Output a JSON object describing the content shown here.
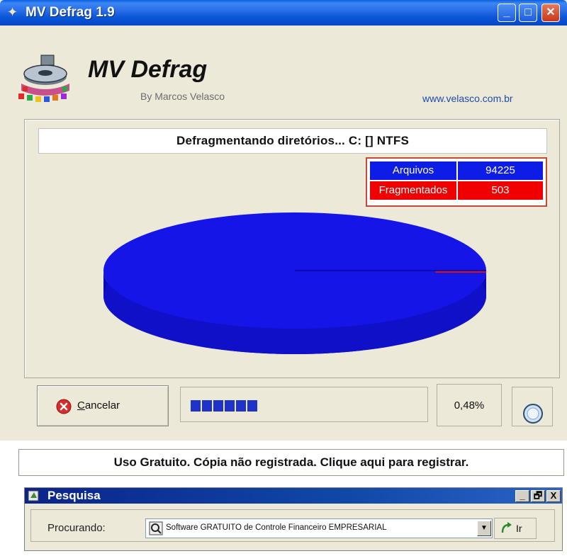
{
  "window": {
    "title": "MV Defrag 1.9",
    "controls": {
      "minimize": "_",
      "maximize": "□",
      "close": "✕"
    }
  },
  "header": {
    "app_name": "MV Defrag",
    "byline": "By Marcos Velasco",
    "url": "www.velasco.com.br",
    "logo_icon": "disk-defrag-logo-icon"
  },
  "status": {
    "text": "Defragmentando diretórios...    C:   []   NTFS"
  },
  "stats": {
    "files_label": "Arquivos",
    "files_value": "94225",
    "fragmented_label": "Fragmentados",
    "fragmented_value": "503",
    "files_color": "#0e1de6",
    "fragmented_color": "#f00000"
  },
  "pie": {
    "fragmented_fraction": 0.0053,
    "main_color": "#1515e8",
    "fragment_color": "#e01010"
  },
  "controls": {
    "cancel_mnemonic": "C",
    "cancel_rest": "ancelar",
    "cancel_icon": "cancel-x-icon",
    "progress_fraction": 0.3,
    "percent_text": "0,48%",
    "spin_icon": "spinner-icon",
    "progress_color": "#1f33c8"
  },
  "registration": {
    "text": "Uso Gratuito.  Cópia não registrada.  Clique aqui para registrar."
  },
  "search_window": {
    "title": "Pesquisa",
    "searching_label": "Procurando:",
    "combo_value": "Software GRATUITO de Controle Financeiro EMPRESARIAL",
    "go_label": "Ir",
    "buttons": {
      "minimize": "_",
      "restore": "🗗",
      "close": "X"
    }
  }
}
